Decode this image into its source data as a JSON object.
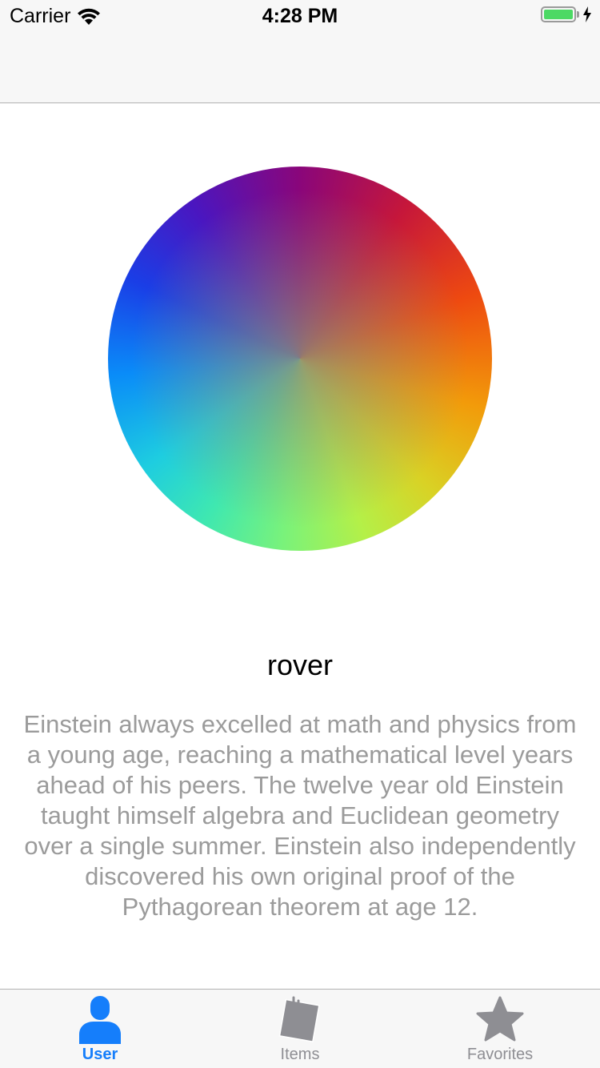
{
  "status_bar": {
    "carrier": "Carrier",
    "time": "4:28 PM",
    "battery_level": 1.0,
    "icons": [
      "wifi-icon",
      "battery-icon",
      "charging-bolt-icon"
    ]
  },
  "profile": {
    "username": "rover",
    "bio": "Einstein always excelled at math and physics from a young age, reaching a mathematical level years ahead of his peers. The twelve year old Einstein taught himself algebra and Euclidean geometry over a single summer. Einstein also independently discovered his own original proof of the Pythagorean theorem at age 12."
  },
  "tab_bar": {
    "tabs": [
      {
        "label": "User",
        "icon": "user-icon",
        "active": true
      },
      {
        "label": "Items",
        "icon": "items-icon",
        "active": false
      },
      {
        "label": "Favorites",
        "icon": "star-icon",
        "active": false
      }
    ]
  },
  "colors": {
    "accent": "#157efb",
    "inactive": "#8e8e93",
    "bio_text": "#9b9b9b",
    "battery": "#4cd964"
  }
}
